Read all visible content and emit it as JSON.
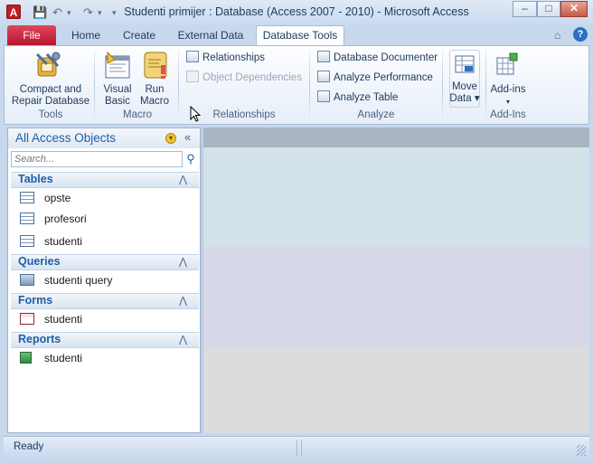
{
  "window": {
    "title": "Studenti primijer : Database (Access 2007 - 2010)  -  Microsoft Access",
    "app_icon": "A",
    "controls": [
      "–",
      "□",
      "✕"
    ]
  },
  "quick_access": [
    "💾",
    "↶",
    "▾",
    "↷",
    "▾",
    "▾"
  ],
  "ribbon": {
    "tabs": [
      {
        "label": "File"
      },
      {
        "label": "Home"
      },
      {
        "label": "Create"
      },
      {
        "label": "External Data"
      },
      {
        "label": "Database Tools"
      }
    ],
    "active_tab": "Database Tools",
    "help_icons": [
      "⌂",
      "?"
    ],
    "groups": {
      "tools": {
        "label": "Tools",
        "compact_line1": "Compact and",
        "compact_line2": "Repair Database"
      },
      "macro": {
        "label": "Macro",
        "vb_line1": "Visual",
        "vb_line2": "Basic",
        "run_line1": "Run",
        "run_line2": "Macro"
      },
      "relationships": {
        "label": "Relationships",
        "relationships": "Relationships",
        "object_dependencies": "Object Dependencies"
      },
      "analyze": {
        "label": "Analyze",
        "documenter": "Database Documenter",
        "performance": "Analyze Performance",
        "table": "Analyze Table"
      },
      "move": {
        "line1": "Move",
        "line2": "Data ▾"
      },
      "addins": {
        "label": "Add-Ins",
        "line1": "Add-ins",
        "line2": "▾"
      }
    }
  },
  "nav": {
    "title": "All Access Objects",
    "dropdown_glyph": "▾",
    "collapse_glyph": "«",
    "search_placeholder": "Search...",
    "categories": [
      {
        "label": "Tables",
        "items": [
          "opste",
          "profesori",
          "studenti"
        ]
      },
      {
        "label": "Queries",
        "items": [
          "studenti query"
        ]
      },
      {
        "label": "Forms",
        "items": [
          "studenti"
        ]
      },
      {
        "label": "Reports",
        "items": [
          "studenti"
        ]
      }
    ],
    "chevron": "⋀"
  },
  "status": {
    "text": "Ready"
  },
  "colors": {
    "accent": "#1e5ea8",
    "file_tab": "#c41e34",
    "chrome": "#c7d8ed"
  }
}
